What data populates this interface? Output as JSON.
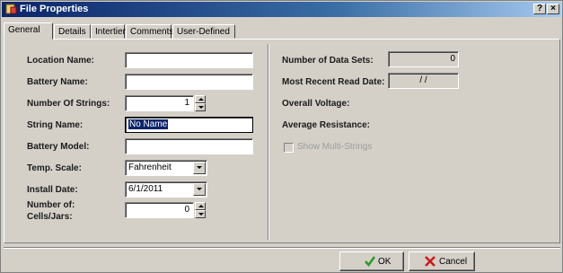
{
  "window": {
    "title": "File Properties",
    "help_label": "?",
    "close_label": "×"
  },
  "tabs": [
    {
      "label": "General"
    },
    {
      "label": "Details"
    },
    {
      "label": "Intertier"
    },
    {
      "label": "Comments"
    },
    {
      "label": "User-Defined"
    }
  ],
  "left": {
    "location_name": {
      "label": "Location Name:",
      "value": ""
    },
    "battery_name": {
      "label": "Battery Name:",
      "value": ""
    },
    "number_of_strings": {
      "label": "Number Of Strings:",
      "value": "1"
    },
    "string_name": {
      "label": "String Name:",
      "value": "No Name"
    },
    "battery_model": {
      "label": "Battery Model:",
      "value": ""
    },
    "temp_scale": {
      "label": "Temp. Scale:",
      "value": "Fahrenheit"
    },
    "install_date": {
      "label": "Install Date:",
      "value": "6/1/2011"
    },
    "number_of_cells": {
      "label_line1": "Number of:",
      "label_line2": "Cells/Jars:",
      "value": "0"
    }
  },
  "right": {
    "data_sets": {
      "label": "Number of Data Sets:",
      "value": "0"
    },
    "recent_read": {
      "label": "Most Recent Read Date:",
      "value": "/ /"
    },
    "overall_voltage": {
      "label": "Overall Voltage:"
    },
    "average_resistance": {
      "label": "Average Resistance:"
    },
    "show_multi_strings": {
      "label": "Show Multi-Strings",
      "checked": false
    }
  },
  "buttons": {
    "ok": "OK",
    "cancel": "Cancel"
  },
  "colors": {
    "title_bar": "#0a246a",
    "ok_check": "#2a9a2a",
    "cancel_x": "#cc1a1a"
  }
}
